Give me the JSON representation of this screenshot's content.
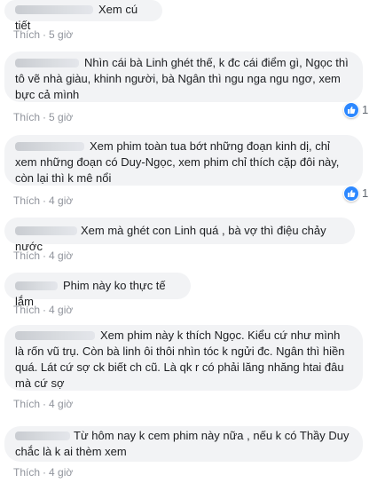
{
  "comments": [
    {
      "text": "Xem cú tiết",
      "time": "5 giờ"
    },
    {
      "text": "Nhìn cái bà Linh ghét thế, k đc cái điểm gì, Ngọc thì tô vẽ nhà giàu, khinh người, bà Ngân thì ngu nga ngu ngơ, xem bực cả mình",
      "time": "5 giờ",
      "likes": "1"
    },
    {
      "text": "Xem phim toàn tua bớt những đoạn kinh dị, chỉ xem những đoạn có Duy-Ngọc, xem phim chỉ thích cặp đôi này, còn lại thì k mê nổi",
      "time": "4 giờ",
      "likes": "1"
    },
    {
      "text": "Xem mà ghét con Linh quá , bà vợ thì điệu chảy nước",
      "time": "4 giờ"
    },
    {
      "text": "Phim này ko thực tế lắm",
      "time": "4 giờ"
    },
    {
      "text": "Xem phim này k thích Ngọc. Kiểu cứ như mình là rốn vũ trụ. Còn bà linh ôi thôi nhìn tóc k ngửi đc. Ngân thì hiền quá. Lát cứ sợ ck biết ch cũ. Là qk r có phải lăng nhăng htai đâu mà cứ sợ",
      "time": "4 giờ"
    },
    {
      "text": "Từ hôm nay k cem phim này nữa , nếu k có Thầy Duy chắc là k ai thèm xem",
      "time": "4 giờ"
    }
  ],
  "action_label": "Thích",
  "separator": "·",
  "colors": {
    "bubble": "#f2f3f5",
    "meta": "#90949c",
    "like": "#2d88ff"
  },
  "icons": {
    "reaction": "like-icon"
  }
}
